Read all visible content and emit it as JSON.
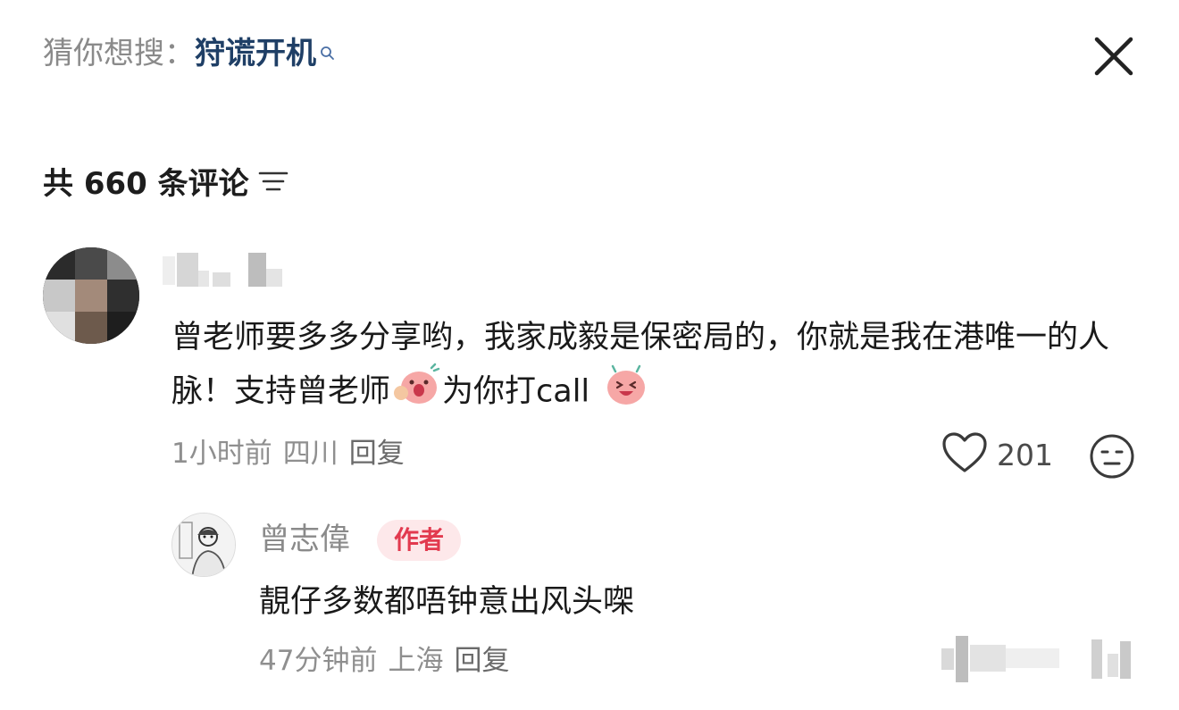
{
  "search": {
    "prefix": "猜你想搜：",
    "keyword": "狩谎开机",
    "search_icon": "search-icon",
    "close_icon": "close-icon"
  },
  "comments_header": {
    "title": "共 660 条评论",
    "sort_icon": "sort-icon"
  },
  "comment": {
    "author_name_hidden": true,
    "text_part1": "曾老师要多多分享哟，我家成毅是保密局的，你就是我在港唯一的人脉！支持曾老师",
    "text_part2": "为你打call",
    "time": "1小时前",
    "location": "四川",
    "reply_label": "回复",
    "likes": "201",
    "like_icon": "heart-icon",
    "dislike_icon": "dislike-face-icon"
  },
  "reply": {
    "author": "曾志偉",
    "badge": "作者",
    "text": "靚仔多数都唔钟意出风头㗎",
    "time": "47分钟前",
    "location": "上海",
    "reply_label": "回复"
  },
  "colors": {
    "keyword": "#1f3f66",
    "badge_bg": "#fde8ea",
    "badge_text": "#e23a4f",
    "meta_gray": "#8f8f8f"
  }
}
